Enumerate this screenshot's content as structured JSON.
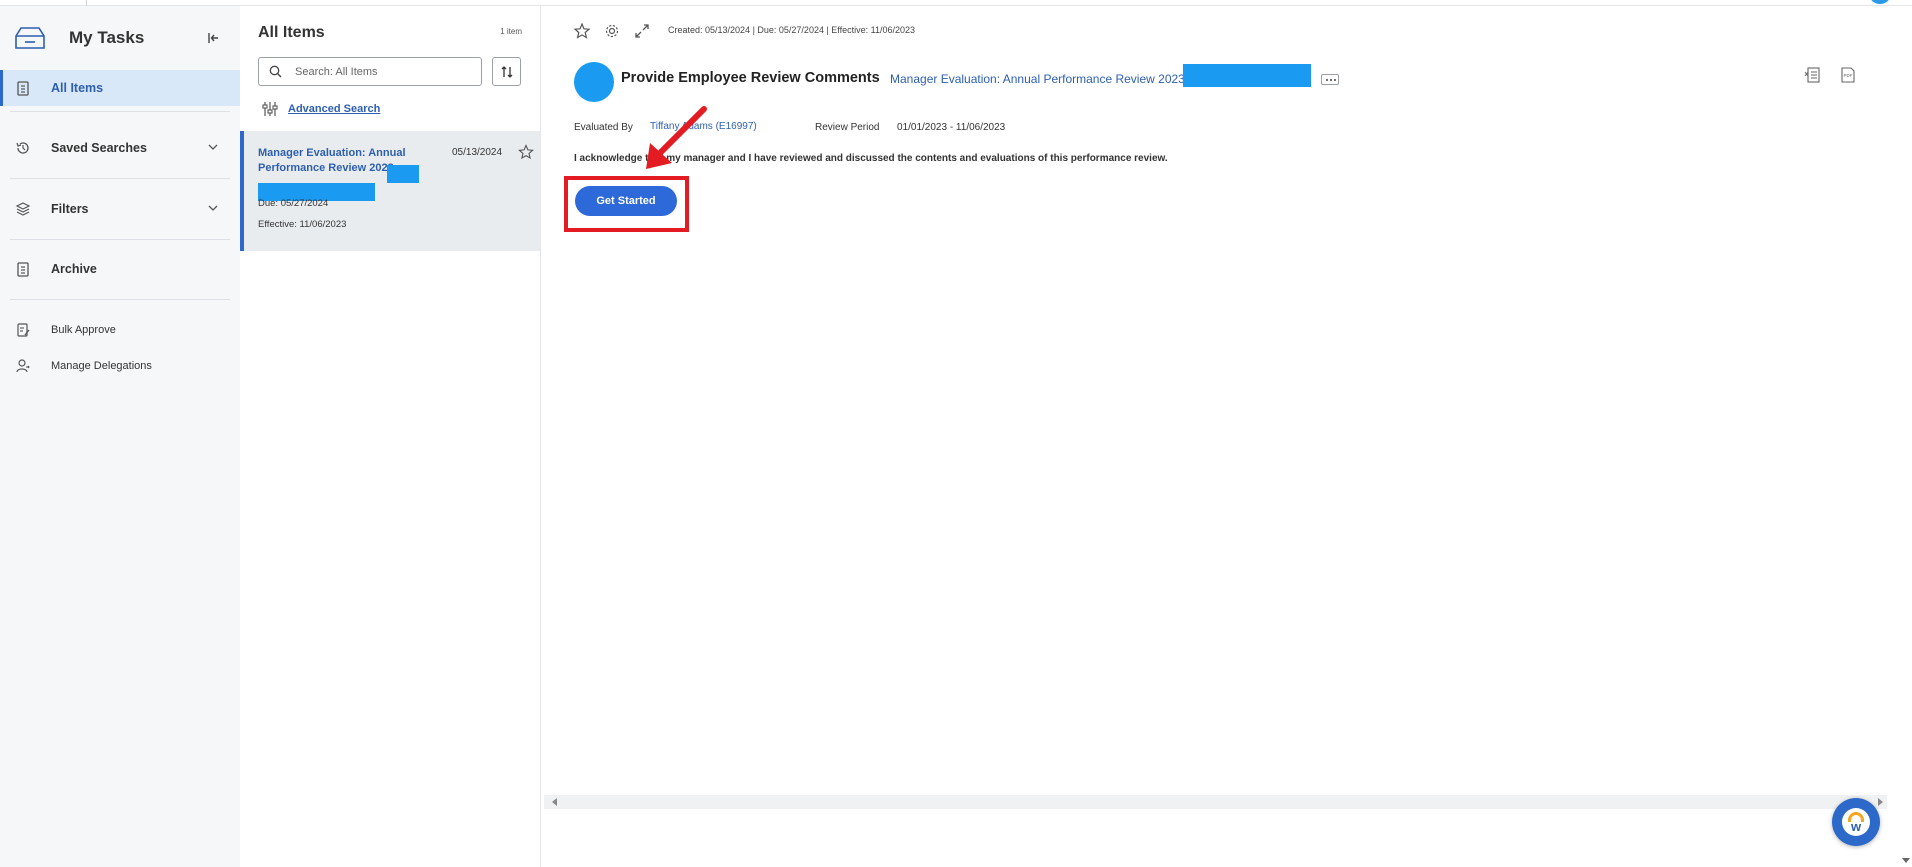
{
  "nav": {
    "title": "My Tasks",
    "items": [
      {
        "label": "All Items"
      },
      {
        "label": "Saved Searches"
      },
      {
        "label": "Filters"
      },
      {
        "label": "Archive"
      },
      {
        "label": "Bulk Approve"
      },
      {
        "label": "Manage Delegations"
      }
    ]
  },
  "list": {
    "title": "All Items",
    "count": "1 item",
    "search_placeholder": "Search: All Items",
    "advanced_search": "Advanced Search",
    "card": {
      "title": "Manager Evaluation: Annual Performance Review 2023:",
      "date": "05/13/2024",
      "due": "Due: 05/27/2024",
      "effective": "Effective: 11/06/2023"
    }
  },
  "main": {
    "meta": "Created: 05/13/2024 | Due: 05/27/2024 | Effective: 11/06/2023",
    "task_title": "Provide Employee Review Comments",
    "task_subtitle": "Manager Evaluation: Annual Performance Review 2023:",
    "evaluated_by_label": "Evaluated By",
    "evaluated_by_value": "Tiffany Adams (E16997)",
    "review_period_label": "Review Period",
    "review_period_value": "01/01/2023 - 11/06/2023",
    "acknowledgement": "I acknowledge that my manager and I have reviewed and discussed the contents and evaluations of this performance review.",
    "get_started": "Get Started"
  },
  "colors": {
    "accent": "#2d69c8",
    "redaction": "#1a9af0",
    "highlight": "#e31b23"
  }
}
